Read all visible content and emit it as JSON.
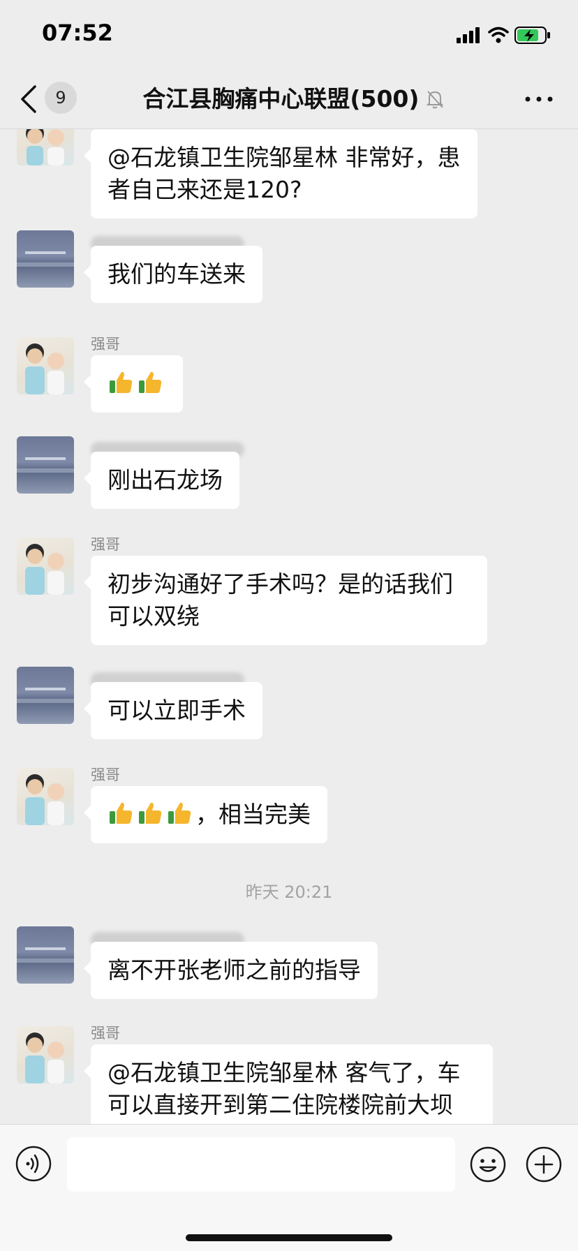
{
  "status_bar": {
    "time": "07:52"
  },
  "header": {
    "unread_count": "9",
    "title": "合江县胸痛中心联盟(500)"
  },
  "messages": [
    {
      "sender": "",
      "text": "@石龙镇卫生院邹星林 非常好，患者自己来还是120?"
    },
    {
      "sender": "",
      "text": "我们的车送来"
    },
    {
      "sender": "强哥",
      "text": ""
    },
    {
      "sender": "",
      "text": "刚出石龙场"
    },
    {
      "sender": "强哥",
      "text": "初步沟通好了手术吗？是的话我们可以双绕"
    },
    {
      "sender": "",
      "text": "可以立即手术"
    },
    {
      "sender": "强哥",
      "text": "，相当完美"
    },
    {
      "sender": "",
      "text": "离不开张老师之前的指导"
    },
    {
      "sender": "强哥",
      "text": "@石龙镇卫生院邹星林 客气了，车可以直接开到第二住院楼院前大坝"
    }
  ],
  "timestamp": "昨天 20:21",
  "input": {
    "value": ""
  },
  "icons": {
    "back": "chevron-left-icon",
    "mute": "bell-off-icon",
    "more": "more-icon",
    "voice": "voice-icon",
    "emoji": "emoji-icon",
    "plus": "plus-icon",
    "thumbs": "thumbs-up-icon"
  },
  "colors": {
    "background": "#ededed",
    "bubble": "#ffffff",
    "sender_text": "#8a8a8a",
    "timestamp_text": "#a3a3a3"
  }
}
